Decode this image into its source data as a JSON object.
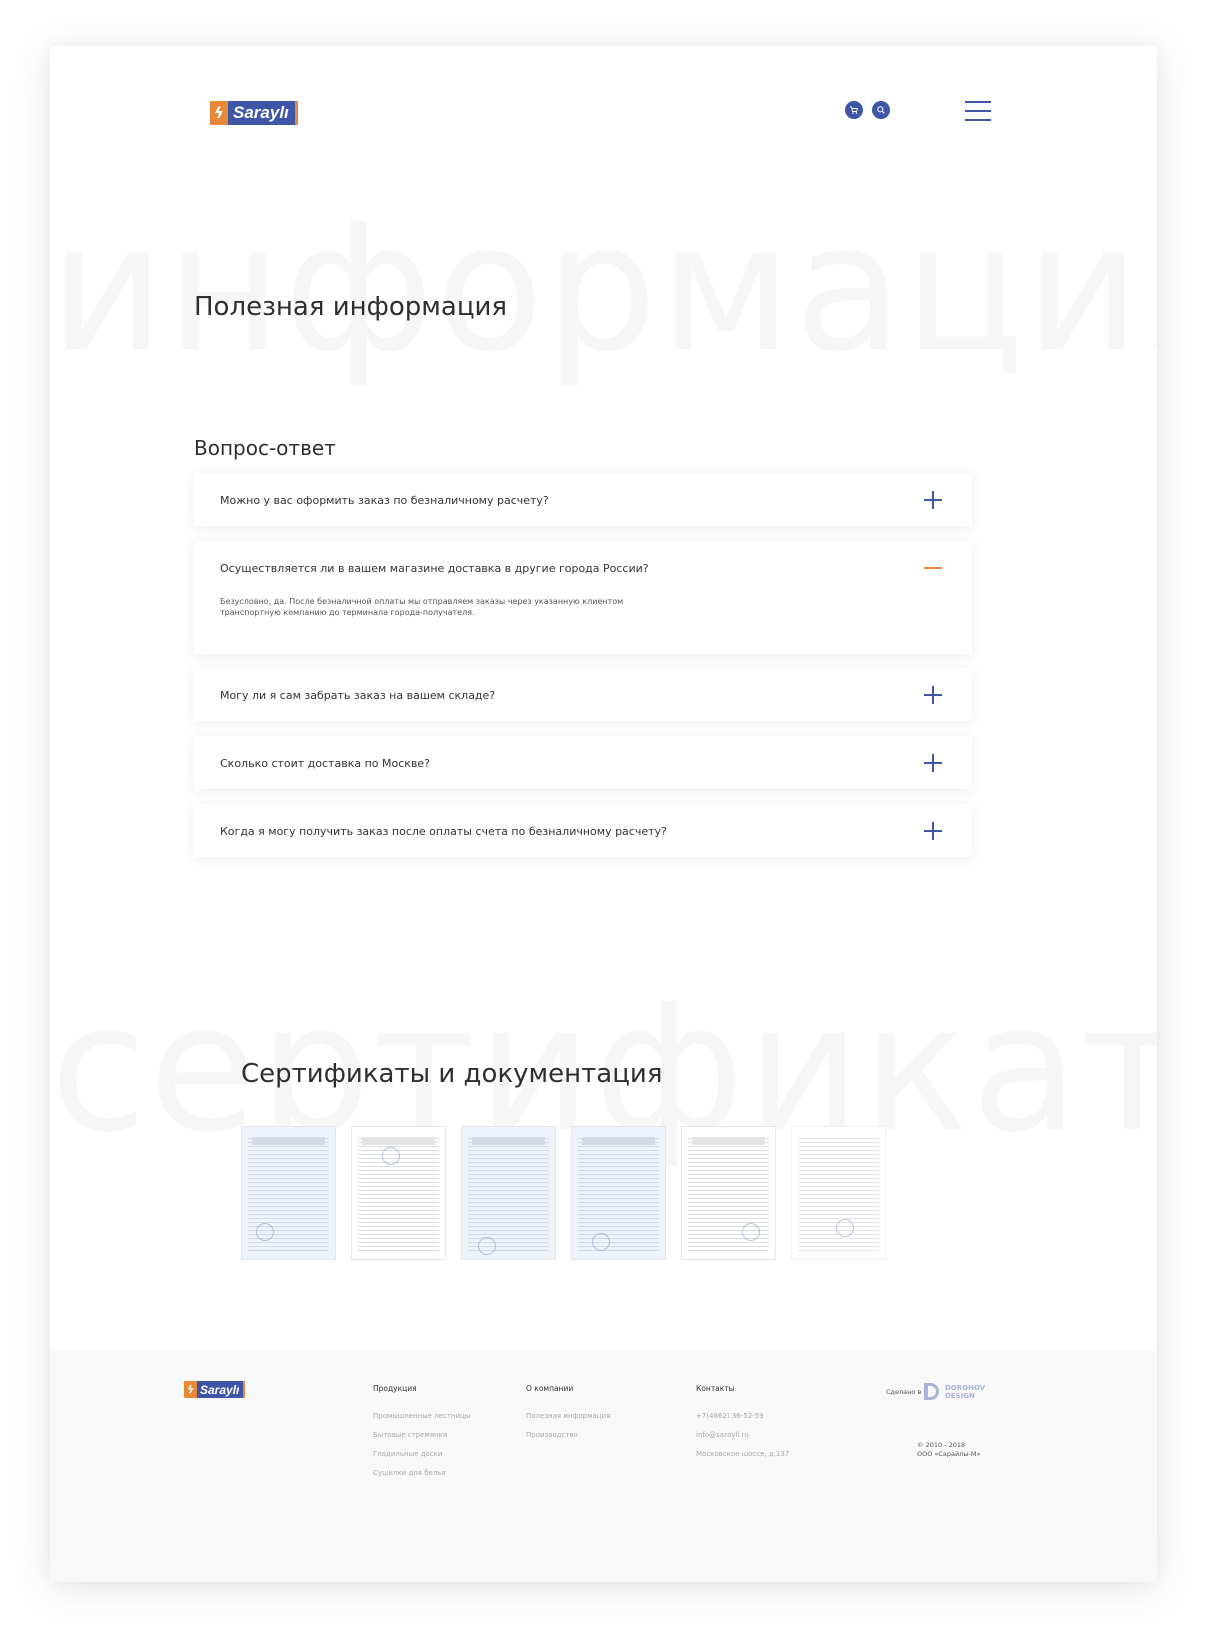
{
  "header": {
    "logo_text": "Saraylı",
    "cart_icon": "cart-icon",
    "search_icon": "search-icon",
    "menu_icon": "hamburger-menu-icon"
  },
  "background_words": {
    "info": "информация",
    "certs": "сертификаты"
  },
  "page_title": "Полезная информация",
  "faq": {
    "title": "Вопрос-ответ",
    "items": [
      {
        "question": "Можно у вас оформить заказ по безналичному расчету?",
        "open": false
      },
      {
        "question": "Осуществляется ли в вашем магазине доставка в другие города России?",
        "open": true,
        "answer": "Безусловно, да. После безналичной оплаты мы отправляем заказы через указанную клиентом транспортную компанию до терминала города-получателя."
      },
      {
        "question": "Могу ли я сам забрать заказ на вашем складе?",
        "open": false
      },
      {
        "question": "Сколько стоит доставка по Москве?",
        "open": false
      },
      {
        "question": "Когда я могу получить заказ после оплаты счета по безналичному расчету?",
        "open": false
      }
    ]
  },
  "certificates": {
    "title": "Сертификаты и документация",
    "count": 6
  },
  "footer": {
    "logo_text": "Saraylı",
    "products": {
      "title": "Продукция",
      "links": [
        "Промышленные лестницы",
        "Бытовые стремянки",
        "Гладильные доски",
        "Сушилки для белья"
      ]
    },
    "company": {
      "title": "О компании",
      "links": [
        "Полезная информация",
        "Производство"
      ]
    },
    "contacts": {
      "title": "Контакты",
      "phone": "+7(4862) 36-52-59",
      "email": "info@sarayli.ru",
      "address": "Московское шоссе, д.137"
    },
    "made_by": "Сделано в",
    "studio_line1": "DOROHOV",
    "studio_line2": "DESIGN",
    "copyright_years": "© 2010 - 2018",
    "copyright_company": "ООО «Сарайлы-М»"
  },
  "colors": {
    "accent_blue": "#3f55a5",
    "accent_orange": "#e8893a"
  }
}
